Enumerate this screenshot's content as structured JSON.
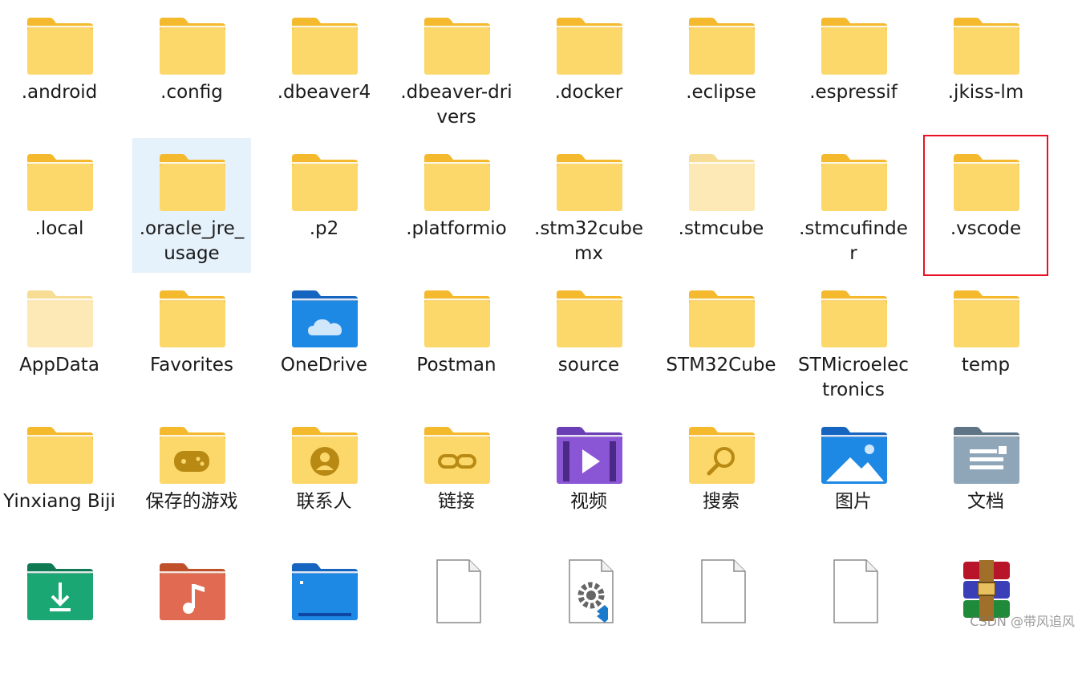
{
  "colors": {
    "folder_back": "#f4b92c",
    "folder_front": "#fcd86a",
    "folder_light_back": "#f7dc93",
    "folder_light_front": "#fde9b6",
    "selection": "#e5f1fb",
    "highlight_box": "#e81123"
  },
  "items": [
    {
      "label": ".android",
      "icon": "folder-icon"
    },
    {
      "label": ".config",
      "icon": "folder-icon"
    },
    {
      "label": ".dbeaver4",
      "icon": "folder-icon"
    },
    {
      "label": ".dbeaver-\ndrivers",
      "icon": "folder-icon"
    },
    {
      "label": ".docker",
      "icon": "folder-icon"
    },
    {
      "label": ".eclipse",
      "icon": "folder-icon"
    },
    {
      "label": ".espressif",
      "icon": "folder-icon"
    },
    {
      "label": ".jkiss-lm",
      "icon": "folder-icon"
    },
    {
      "label": ".local",
      "icon": "folder-icon"
    },
    {
      "label": ".oracle_jre_usage",
      "icon": "folder-icon",
      "state": "selected"
    },
    {
      "label": ".p2",
      "icon": "folder-icon"
    },
    {
      "label": ".platformio",
      "icon": "folder-icon"
    },
    {
      "label": ".stm32cubemx",
      "icon": "folder-icon"
    },
    {
      "label": ".stmcube",
      "icon": "folder-light-icon"
    },
    {
      "label": ".stmcufinder",
      "icon": "folder-icon"
    },
    {
      "label": ".vscode",
      "icon": "folder-icon",
      "state": "outlined"
    },
    {
      "label": "AppData",
      "icon": "folder-light-icon"
    },
    {
      "label": "Favorites",
      "icon": "folder-icon"
    },
    {
      "label": "OneDrive",
      "icon": "onedrive-folder-icon"
    },
    {
      "label": "Postman",
      "icon": "folder-icon"
    },
    {
      "label": "source",
      "icon": "folder-icon"
    },
    {
      "label": "STM32Cube",
      "icon": "folder-icon"
    },
    {
      "label": "STMicroelectronics",
      "icon": "folder-icon"
    },
    {
      "label": "temp",
      "icon": "folder-icon"
    },
    {
      "label": "Yinxiang Biji",
      "icon": "folder-icon"
    },
    {
      "label": "保存的游戏",
      "icon": "saved-games-folder-icon"
    },
    {
      "label": "联系人",
      "icon": "contacts-folder-icon"
    },
    {
      "label": "链接",
      "icon": "links-folder-icon"
    },
    {
      "label": "视频",
      "icon": "videos-folder-icon"
    },
    {
      "label": "搜索",
      "icon": "searches-folder-icon"
    },
    {
      "label": "图片",
      "icon": "pictures-folder-icon"
    },
    {
      "label": "文档",
      "icon": "documents-folder-icon"
    },
    {
      "label": "",
      "icon": "downloads-folder-icon"
    },
    {
      "label": "",
      "icon": "music-folder-icon"
    },
    {
      "label": "",
      "icon": "desktop-folder-icon"
    },
    {
      "label": "",
      "icon": "blank-file-icon"
    },
    {
      "label": "",
      "icon": "vscode-settings-file-icon"
    },
    {
      "label": "",
      "icon": "blank-file-icon"
    },
    {
      "label": "",
      "icon": "blank-file-icon"
    },
    {
      "label": "",
      "icon": "winrar-archive-icon"
    }
  ],
  "watermark": "CSDN @带风追风"
}
